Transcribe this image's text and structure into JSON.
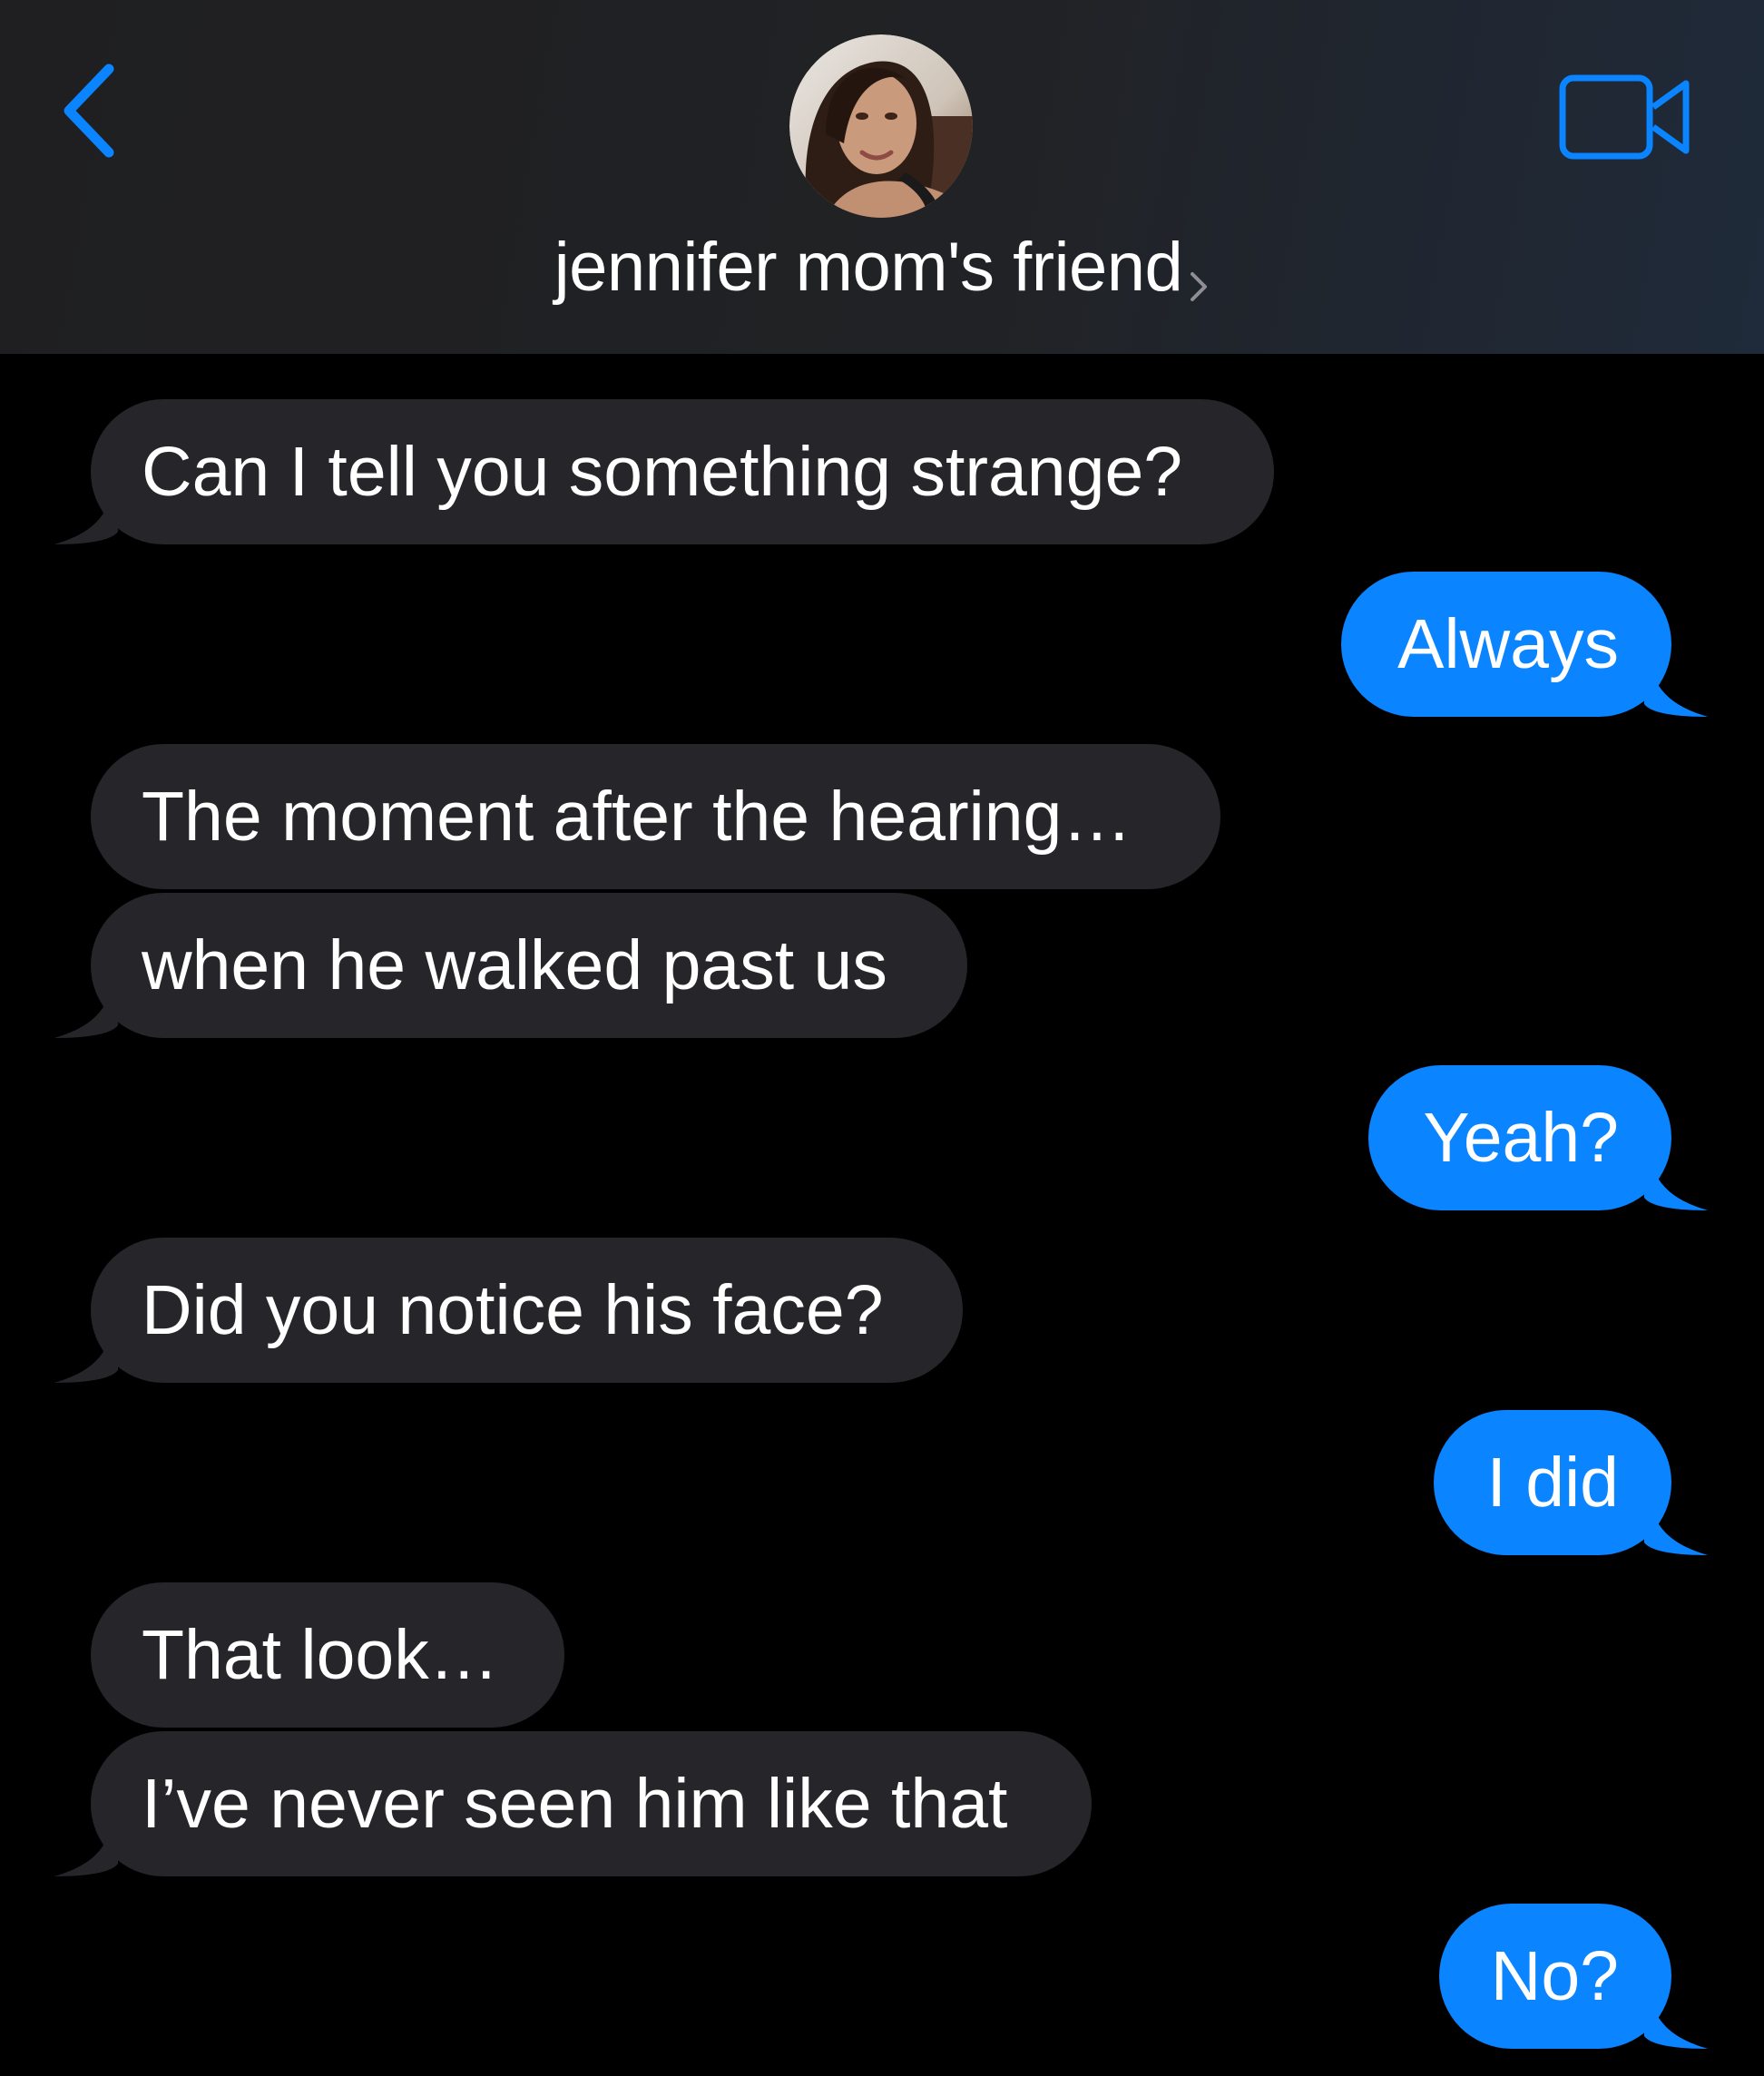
{
  "header": {
    "contact_name": "jennifer mom's friend",
    "back_icon": "chevron-left-icon",
    "video_icon": "video-camera-icon",
    "accent_color": "#0a84ff"
  },
  "messages": [
    {
      "id": "m1",
      "direction": "received",
      "text": "Can I tell you something strange?"
    },
    {
      "id": "m2",
      "direction": "sent",
      "text": "Always"
    },
    {
      "id": "m3",
      "direction": "received",
      "text": "The moment after the hearing…"
    },
    {
      "id": "m4",
      "direction": "received",
      "text": "when he walked past us"
    },
    {
      "id": "m5",
      "direction": "sent",
      "text": "Yeah?"
    },
    {
      "id": "m6",
      "direction": "received",
      "text": "Did you notice his face?"
    },
    {
      "id": "m7",
      "direction": "sent",
      "text": "I did"
    },
    {
      "id": "m8",
      "direction": "received",
      "text": "That look…"
    },
    {
      "id": "m9",
      "direction": "received",
      "text": "I’ve never seen him like that"
    },
    {
      "id": "m10",
      "direction": "sent",
      "text": "No?"
    }
  ],
  "colors": {
    "received_bubble": "#26262a",
    "sent_bubble": "#0a84ff",
    "background": "#000000"
  }
}
